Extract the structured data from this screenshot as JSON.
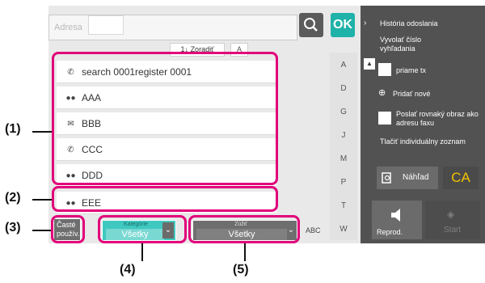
{
  "address_field": {
    "placeholder": "Adresa"
  },
  "toolbar": {
    "ok_label": "OK",
    "sort_label": "Zoradiť",
    "sort_icon_label": "A",
    "alpha_prefix": "1↓"
  },
  "entries": [
    {
      "icon": "phone-icon",
      "label": "search 0001register 0001"
    },
    {
      "icon": "group-icon",
      "label": "AAA"
    },
    {
      "icon": "email-icon",
      "label": "BBB"
    },
    {
      "icon": "phone-icon",
      "label": "CCC"
    },
    {
      "icon": "group-icon",
      "label": "DDD"
    },
    {
      "icon": "group-icon",
      "label": "EEE"
    }
  ],
  "alphabet": [
    "A",
    "D",
    "G",
    "J",
    "M",
    "P",
    "T",
    "W"
  ],
  "abc_label": "ABC",
  "bottom": {
    "frequent_label": "Časté použív.",
    "category": {
      "title": "Kategórie",
      "value": "Všetky"
    },
    "narrow": {
      "title": "Zúžiť",
      "value": "Všetky"
    }
  },
  "side": {
    "history": "História odoslania",
    "recall": "Vyvolať číslo vyhľadania",
    "direct_tx": "priame tx",
    "add_new": "Pridať nové",
    "same_image": "Poslať rovnaký obraz ako adresu faxu",
    "print_individual": "Tlačiť individuálny zoznam",
    "preview": "Náhľad",
    "ca": "CA",
    "play": "Reprod.",
    "start": "Start"
  },
  "callouts": [
    "(1)",
    "(2)",
    "(3)",
    "(4)",
    "(5)"
  ],
  "colors": {
    "accent": "#1fb2a8",
    "highlight_frame": "#e2007a",
    "panel": "#525252"
  }
}
